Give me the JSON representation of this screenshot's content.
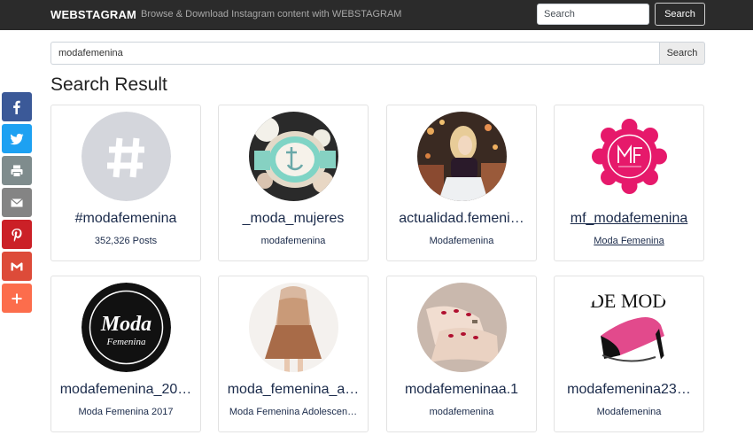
{
  "navbar": {
    "brand": "WEBSTAGRAM",
    "tagline": "Browse & Download Instagram content with WEBSTAGRAM",
    "search_placeholder": "Search",
    "search_button": "Search"
  },
  "search": {
    "value": "modafemenina",
    "button": "Search"
  },
  "page_title": "Search Result",
  "share": [
    {
      "name": "facebook",
      "color": "#3b5998"
    },
    {
      "name": "twitter",
      "color": "#1da1f2"
    },
    {
      "name": "print",
      "color": "#7f8c8d"
    },
    {
      "name": "email",
      "color": "#848484"
    },
    {
      "name": "pinterest",
      "color": "#cb2027"
    },
    {
      "name": "gmail",
      "color": "#dd4b39"
    },
    {
      "name": "more",
      "color": "#fc6d4c"
    }
  ],
  "results": [
    {
      "title": "#modafemenina",
      "subtitle": "352,326 Posts",
      "icon": "hashtag-icon"
    },
    {
      "title": "_moda_mujeres",
      "subtitle": "modafemenina",
      "icon": "watch-photo"
    },
    {
      "title": "actualidad.femeni…",
      "subtitle": "Modafemenina",
      "icon": "woman-photo"
    },
    {
      "title": "mf_modafemenina",
      "subtitle": "Moda Femenina",
      "icon": "mf-logo",
      "hovered": true
    },
    {
      "title": "modafemenina_20…",
      "subtitle": "Moda Femenina 2017",
      "icon": "moda-femenina-logo",
      "logo_text": [
        "Moda",
        "Femenina"
      ]
    },
    {
      "title": "moda_femenina_a…",
      "subtitle": "Moda Femenina Adolescen…",
      "icon": "outfit-photo"
    },
    {
      "title": "modafemeninaa.1",
      "subtitle": "modafemenina",
      "icon": "hands-photo"
    },
    {
      "title": "modafemenina23…",
      "subtitle": "Modafemenina",
      "icon": "shoe-photo",
      "logo_text": [
        "DE MOD"
      ]
    }
  ]
}
